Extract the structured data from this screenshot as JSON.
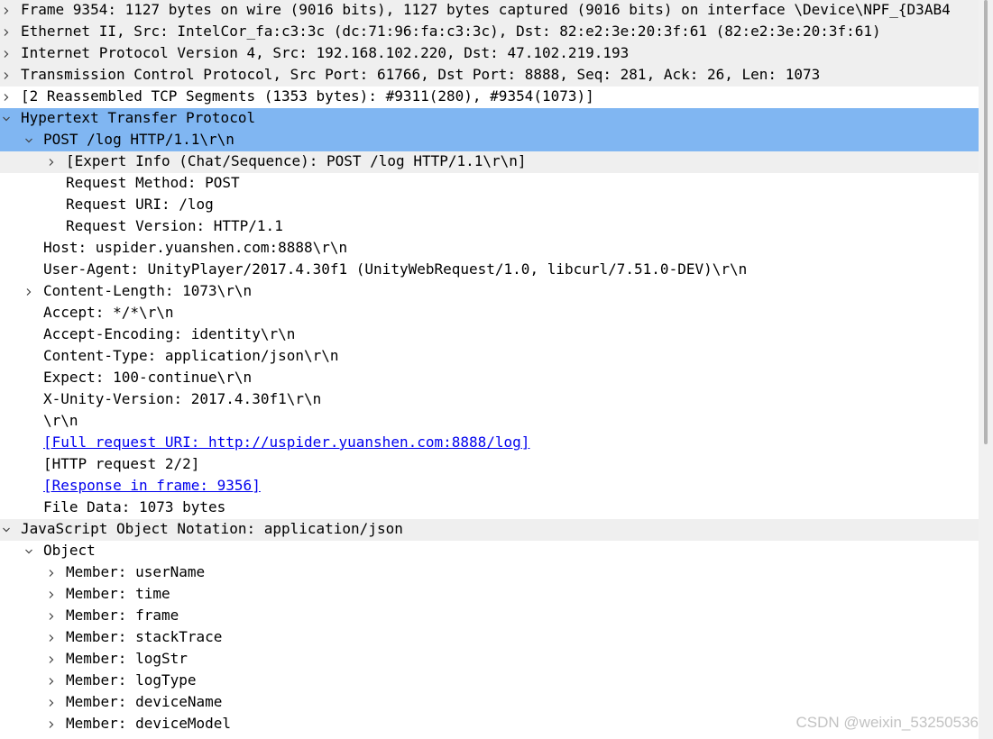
{
  "tree": {
    "rows": [
      {
        "name": "frame-row",
        "text": "Frame 9354: 1127 bytes on wire (9016 bits), 1127 bytes captured (9016 bits) on interface \\Device\\NPF_{D3AB4",
        "level": 0,
        "toggle": "collapsed",
        "style": "shade",
        "link": false
      },
      {
        "name": "ethernet-row",
        "text": "Ethernet II, Src: IntelCor_fa:c3:3c (dc:71:96:fa:c3:3c), Dst: 82:e2:3e:20:3f:61 (82:e2:3e:20:3f:61)",
        "level": 0,
        "toggle": "collapsed",
        "style": "shade",
        "link": false
      },
      {
        "name": "ipv4-row",
        "text": "Internet Protocol Version 4, Src: 192.168.102.220, Dst: 47.102.219.193",
        "level": 0,
        "toggle": "collapsed",
        "style": "shade",
        "link": false
      },
      {
        "name": "tcp-row",
        "text": "Transmission Control Protocol, Src Port: 61766, Dst Port: 8888, Seq: 281, Ack: 26, Len: 1073",
        "level": 0,
        "toggle": "collapsed",
        "style": "shade",
        "link": false
      },
      {
        "name": "reassembled-row",
        "text": "[2 Reassembled TCP Segments (1353 bytes): #9311(280), #9354(1073)]",
        "level": 0,
        "toggle": "collapsed",
        "style": "",
        "link": false
      },
      {
        "name": "http-row",
        "text": "Hypertext Transfer Protocol",
        "level": 0,
        "toggle": "expanded",
        "style": "sel",
        "link": false
      },
      {
        "name": "request-line-row",
        "text": "POST /log HTTP/1.1\\r\\n",
        "level": 1,
        "toggle": "expanded",
        "style": "sel",
        "link": false
      },
      {
        "name": "expert-info-row",
        "text": "[Expert Info (Chat/Sequence): POST /log HTTP/1.1\\r\\n]",
        "level": 2,
        "toggle": "collapsed",
        "style": "shade",
        "link": false
      },
      {
        "name": "request-method-row",
        "text": "Request Method: POST",
        "level": 2,
        "toggle": "none",
        "style": "",
        "link": false
      },
      {
        "name": "request-uri-row",
        "text": "Request URI: /log",
        "level": 2,
        "toggle": "none",
        "style": "",
        "link": false
      },
      {
        "name": "request-version-row",
        "text": "Request Version: HTTP/1.1",
        "level": 2,
        "toggle": "none",
        "style": "",
        "link": false
      },
      {
        "name": "host-row",
        "text": "Host: uspider.yuanshen.com:8888\\r\\n",
        "level": 1,
        "toggle": "none",
        "style": "",
        "link": false
      },
      {
        "name": "user-agent-row",
        "text": "User-Agent: UnityPlayer/2017.4.30f1 (UnityWebRequest/1.0, libcurl/7.51.0-DEV)\\r\\n",
        "level": 1,
        "toggle": "none",
        "style": "",
        "link": false
      },
      {
        "name": "content-length-row",
        "text": "Content-Length: 1073\\r\\n",
        "level": 1,
        "toggle": "collapsed",
        "style": "",
        "link": false
      },
      {
        "name": "accept-row",
        "text": "Accept: */*\\r\\n",
        "level": 1,
        "toggle": "none",
        "style": "",
        "link": false
      },
      {
        "name": "accept-encoding-row",
        "text": "Accept-Encoding: identity\\r\\n",
        "level": 1,
        "toggle": "none",
        "style": "",
        "link": false
      },
      {
        "name": "content-type-row",
        "text": "Content-Type: application/json\\r\\n",
        "level": 1,
        "toggle": "none",
        "style": "",
        "link": false
      },
      {
        "name": "expect-row",
        "text": "Expect: 100-continue\\r\\n",
        "level": 1,
        "toggle": "none",
        "style": "",
        "link": false
      },
      {
        "name": "unity-version-row",
        "text": "X-Unity-Version: 2017.4.30f1\\r\\n",
        "level": 1,
        "toggle": "none",
        "style": "",
        "link": false
      },
      {
        "name": "crlf-row",
        "text": "\\r\\n",
        "level": 1,
        "toggle": "none",
        "style": "",
        "link": false
      },
      {
        "name": "full-request-uri-link",
        "text": "[Full request URI: http://uspider.yuanshen.com:8888/log]",
        "level": 1,
        "toggle": "none",
        "style": "",
        "link": true
      },
      {
        "name": "http-request-count-row",
        "text": "[HTTP request 2/2]",
        "level": 1,
        "toggle": "none",
        "style": "",
        "link": false
      },
      {
        "name": "response-frame-link",
        "text": "[Response in frame: 9356]",
        "level": 1,
        "toggle": "none",
        "style": "",
        "link": true
      },
      {
        "name": "file-data-row",
        "text": "File Data: 1073 bytes",
        "level": 1,
        "toggle": "none",
        "style": "",
        "link": false
      },
      {
        "name": "json-row",
        "text": "JavaScript Object Notation: application/json",
        "level": 0,
        "toggle": "expanded",
        "style": "shade",
        "link": false
      },
      {
        "name": "object-row",
        "text": "Object",
        "level": 1,
        "toggle": "expanded",
        "style": "",
        "link": false
      },
      {
        "name": "member-username-row",
        "text": "Member: userName",
        "level": 2,
        "toggle": "collapsed",
        "style": "",
        "link": false
      },
      {
        "name": "member-time-row",
        "text": "Member: time",
        "level": 2,
        "toggle": "collapsed",
        "style": "",
        "link": false
      },
      {
        "name": "member-frame-row",
        "text": "Member: frame",
        "level": 2,
        "toggle": "collapsed",
        "style": "",
        "link": false
      },
      {
        "name": "member-stacktrace-row",
        "text": "Member: stackTrace",
        "level": 2,
        "toggle": "collapsed",
        "style": "",
        "link": false
      },
      {
        "name": "member-logstr-row",
        "text": "Member: logStr",
        "level": 2,
        "toggle": "collapsed",
        "style": "",
        "link": false
      },
      {
        "name": "member-logtype-row",
        "text": "Member: logType",
        "level": 2,
        "toggle": "collapsed",
        "style": "",
        "link": false
      },
      {
        "name": "member-devicename-row",
        "text": "Member: deviceName",
        "level": 2,
        "toggle": "collapsed",
        "style": "",
        "link": false
      },
      {
        "name": "member-devicemodel-row",
        "text": "Member: deviceModel",
        "level": 2,
        "toggle": "collapsed",
        "style": "",
        "link": false
      },
      {
        "name": "member-cut-off-row",
        "text": "",
        "level": 2,
        "toggle": "collapsed",
        "style": "last",
        "link": false
      }
    ]
  },
  "colors": {
    "selected_bg": "#80b6f2",
    "shade_bg": "#efefef",
    "link": "#0000ee"
  },
  "icons": {
    "collapsed": "chevron-right-icon",
    "expanded": "chevron-down-icon"
  },
  "watermark": "CSDN @weixin_53250536"
}
